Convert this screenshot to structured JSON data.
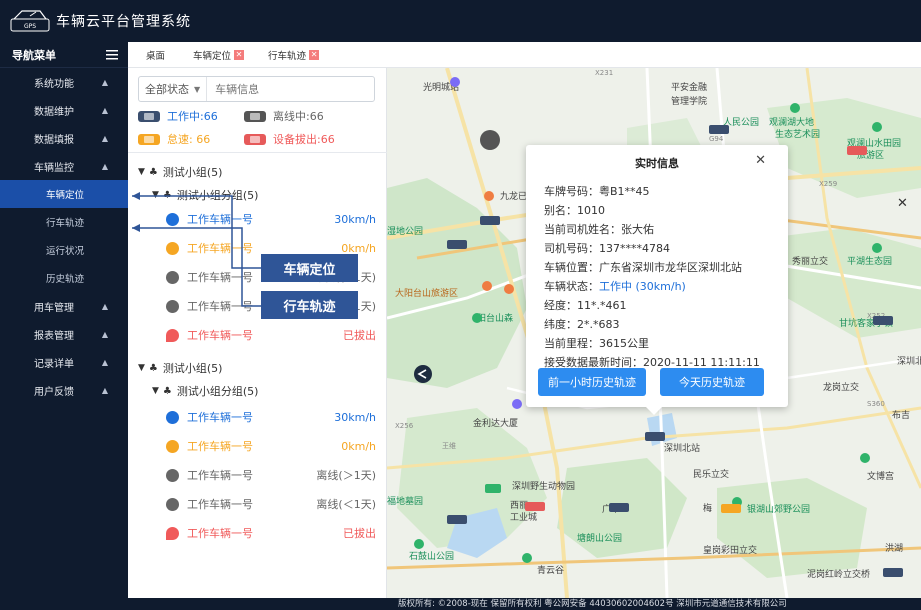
{
  "app": {
    "title": "车辆云平台管理系统",
    "logo_text": "GPS"
  },
  "sidebar": {
    "header": "导航菜单",
    "items": [
      {
        "label": "系统功能"
      },
      {
        "label": "数据维护"
      },
      {
        "label": "数据填报"
      },
      {
        "label": "车辆监控"
      }
    ],
    "sub_items": [
      {
        "label": "车辆定位",
        "active": true
      },
      {
        "label": "行车轨迹"
      },
      {
        "label": "运行状况"
      },
      {
        "label": "历史轨迹"
      }
    ],
    "items_after": [
      {
        "label": "用车管理"
      },
      {
        "label": "报表管理"
      },
      {
        "label": "记录详单"
      },
      {
        "label": "用户反馈"
      }
    ]
  },
  "tabs": [
    {
      "label": "桌面",
      "closable": false
    },
    {
      "label": "车辆定位",
      "closable": true
    },
    {
      "label": "行车轨迹",
      "closable": true
    }
  ],
  "panel": {
    "filter_select": "全部状态",
    "search_placeholder": "车辆信息",
    "stats": {
      "working": "工作中:66",
      "offline": "离线中:66",
      "sudden": "怠速: 66",
      "unplugged": "设备拔出:66"
    },
    "groups": [
      {
        "name": "测试小组(5)",
        "subgroup": "测试小组分组(5)",
        "vehicles": [
          {
            "name": "工作车辆一号",
            "status": "30km/h",
            "kind": "working"
          },
          {
            "name": "工作车辆一号",
            "status": "0km/h",
            "kind": "idle"
          },
          {
            "name": "工作车辆一号",
            "status": "离线(>1天)",
            "kind": "offline"
          },
          {
            "name": "工作车辆一号",
            "status": "离线(<1天)",
            "kind": "offline"
          },
          {
            "name": "工作车辆一号",
            "status": "已拔出",
            "kind": "unplugged"
          }
        ]
      },
      {
        "name": "测试小组(5)",
        "subgroup": "测试小组分组(5)",
        "vehicles": [
          {
            "name": "工作车辆一号",
            "status": "30km/h",
            "kind": "working"
          },
          {
            "name": "工作车辆一号",
            "status": "0km/h",
            "kind": "idle"
          },
          {
            "name": "工作车辆一号",
            "status": "离线(＞1天)",
            "kind": "offline"
          },
          {
            "name": "工作车辆一号",
            "status": "离线(＜1天)",
            "kind": "offline"
          },
          {
            "name": "工作车辆一号",
            "status": "已拔出",
            "kind": "unplugged"
          }
        ]
      }
    ]
  },
  "callouts": {
    "locate": "车辆定位",
    "track": "行车轨迹"
  },
  "popup": {
    "title": "实时信息",
    "plate": "车牌号码：粤B1**45",
    "alias": "别名：1010",
    "driver": "当前司机姓名：张大佑",
    "phone": "司机号码：137****4784",
    "location": "车辆位置：广东省深圳市龙华区深圳北站",
    "status_label": "车辆状态：",
    "status_value": "工作中 (30km/h)",
    "lng": "经度：11*.*461",
    "lat": "纬度：2*.*683",
    "mileage": "当前里程：3615公里",
    "last_time": "接受数据最新时间：2020-11-11 11:11:11",
    "btn_hour": "前一小时历史轨迹",
    "btn_today": "今天历史轨迹"
  },
  "map": {
    "places": {
      "guangming": "光明城站",
      "pingan": "平安金融",
      "guanli": "管理学院",
      "renmin": "人民公园",
      "guanlan": "观澜湖大地",
      "shengtai": "生态艺术园",
      "shanshui": "观澜山水田园",
      "lvyou": "旅游区",
      "jiulong": "九龙已",
      "shidi": "湿地公园",
      "dayangshan": "大阳台山旅游区",
      "yangtaishan": "阳台山森",
      "xiuli": "秀丽立交",
      "pingshan": "平湖生态园",
      "ganken": "甘坑客家小镇",
      "shenbeishen": "深圳北",
      "longgang": "龙岗立交",
      "buji": "布吉",
      "jinlida": "金利达大厦",
      "shenzhenbei": "深圳北站",
      "minle": "民乐立交",
      "wenbo": "文博宫",
      "shengwu": "深圳野生动物园",
      "fudi": "福地墓园",
      "xili": "西丽",
      "gongye": "工业城",
      "meilin": "梅",
      "yinhu": "银湖山郊野公园",
      "shiyanshan": "石鼓山公园",
      "qingyun": "青云谷",
      "tangfeng": "塘朗山公园",
      "huanggang": "皇岗彩田立交",
      "honghu": "洪湖",
      "niwang": "泥岗红岭立交桥",
      "guanghe": "广平",
      "wanghang": "王维",
      "roadX231": "X231",
      "roadX259": "X259",
      "roadX256": "X256",
      "roadX252": "X252",
      "roadG94": "G94",
      "roadS360": "S360"
    },
    "zoom_close": "✕"
  },
  "footer": "版权所有: ©2008-现在 保留所有权利 粤公网安备 44030602004602号 深圳市元道通信技术有限公司",
  "colors": {
    "nav_bg": "#0f1b2e",
    "active": "#1b4fa8",
    "blue": "#1e6fd9",
    "orange": "#f5a623",
    "gray": "#666666",
    "red": "#f05a5a"
  }
}
